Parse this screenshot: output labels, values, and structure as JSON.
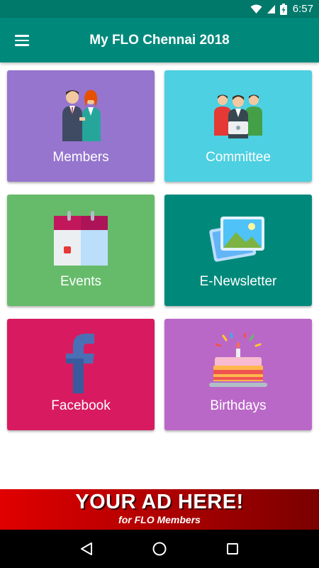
{
  "status_bar": {
    "time": "6:57",
    "icons": [
      "wifi-icon",
      "signal-icon",
      "battery-charging-icon"
    ]
  },
  "app_bar": {
    "title": "My FLO Chennai 2018",
    "menu_icon": "hamburger-menu-icon"
  },
  "tiles": [
    {
      "label": "Members",
      "icon": "members-people-icon",
      "color": "#9575cd"
    },
    {
      "label": "Committee",
      "icon": "committee-group-icon",
      "color": "#4dd0e1"
    },
    {
      "label": "Events",
      "icon": "calendar-icon",
      "color": "#66bb6a"
    },
    {
      "label": "E-Newsletter",
      "icon": "gallery-image-icon",
      "color": "#00897b"
    },
    {
      "label": "Facebook",
      "icon": "facebook-icon",
      "color": "#d81b60"
    },
    {
      "label": "Birthdays",
      "icon": "birthday-cake-icon",
      "color": "#ba68c8"
    }
  ],
  "ad_banner": {
    "title": "YOUR AD HERE!",
    "subtitle": "for FLO Members"
  },
  "nav_bar": {
    "icons": [
      "back-icon",
      "home-icon",
      "recents-icon"
    ]
  },
  "colors": {
    "status_bar": "#00796b",
    "app_bar": "#00897b",
    "ad_red": "#d00000"
  }
}
